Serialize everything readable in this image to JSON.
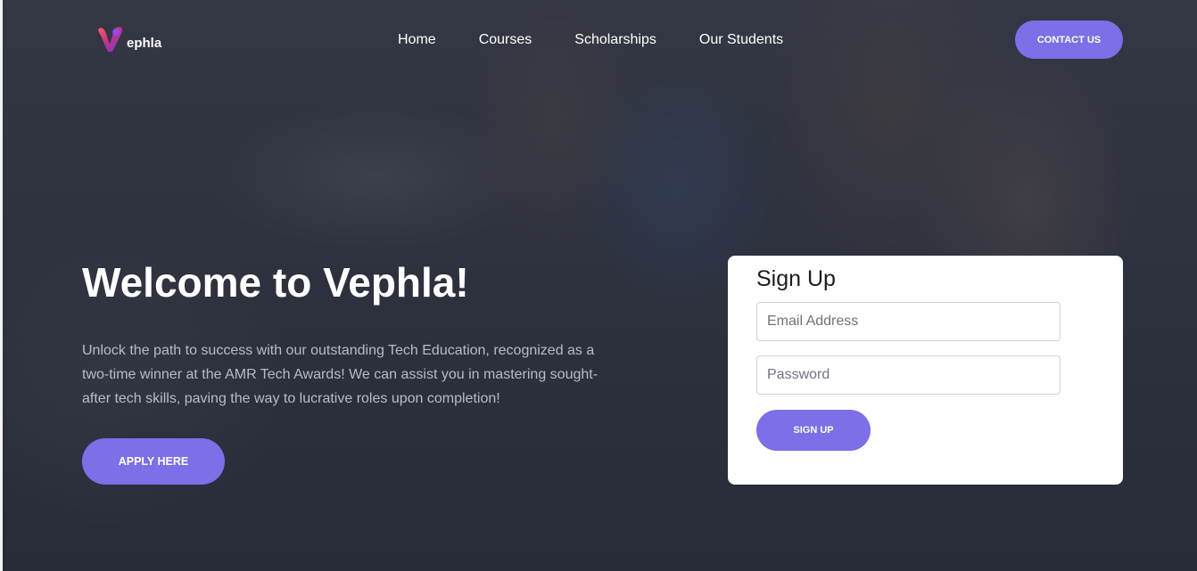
{
  "brand": {
    "logo_text": "ephla",
    "logo_icon": "vephla-v-logo-icon"
  },
  "nav": {
    "items": [
      {
        "label": "Home"
      },
      {
        "label": "Courses"
      },
      {
        "label": "Scholarships"
      },
      {
        "label": "Our Students"
      }
    ],
    "contact_label": "CONTACT US"
  },
  "hero": {
    "title": "Welcome to Vephla!",
    "description": "Unlock the path to success with our outstanding Tech Education, recognized as a two-time winner at the AMR Tech Awards! We can assist you in mastering sought-after tech skills, paving the way to lucrative roles upon completion!",
    "apply_label": "APPLY HERE"
  },
  "signup": {
    "title": "Sign Up",
    "email_placeholder": "Email Address",
    "password_placeholder": "Password",
    "button_label": "SIGN UP"
  },
  "colors": {
    "accent": "#7c6fe8",
    "overlay": "#262a37",
    "card": "#ffffff"
  }
}
